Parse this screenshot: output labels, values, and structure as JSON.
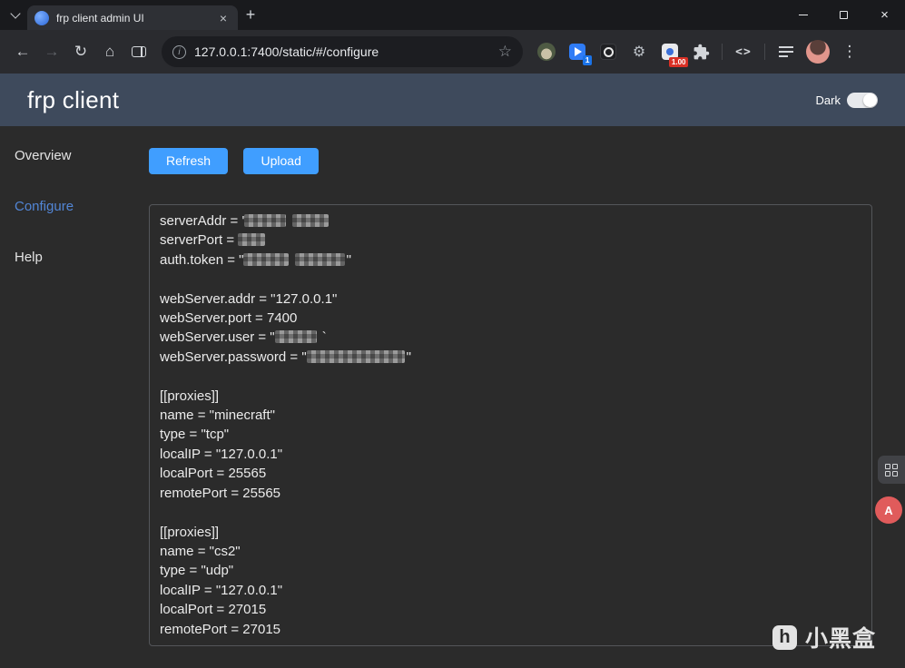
{
  "colors": {
    "primary": "#409eff",
    "header-bg": "#3e4a5c",
    "link-active": "#5286d6",
    "page-bg": "#2b2b2b"
  },
  "browser": {
    "tab_title": "frp client admin UI",
    "url": "127.0.0.1:7400/static/#/configure",
    "flag_badge": "1",
    "red_badge": "1.00",
    "code_glyph": "<>"
  },
  "page": {
    "title": "frp client",
    "theme_label": "Dark",
    "sidebar": [
      "Overview",
      "Configure",
      "Help"
    ],
    "buttons": {
      "refresh": "Refresh",
      "upload": "Upload"
    },
    "config_lines": [
      [
        {
          "t": "serverAddr = '"
        },
        {
          "r": 46
        },
        {
          "t": " "
        },
        {
          "r": 40
        }
      ],
      [
        {
          "t": "serverPort = "
        },
        {
          "r": 30
        }
      ],
      [
        {
          "t": "auth.token = \""
        },
        {
          "r": 50
        },
        {
          "t": " "
        },
        {
          "r": 55
        },
        {
          "t": "\""
        }
      ],
      [],
      [
        {
          "t": "webServer.addr = \"127.0.0.1\""
        }
      ],
      [
        {
          "t": "webServer.port = 7400"
        }
      ],
      [
        {
          "t": "webServer.user = \""
        },
        {
          "r": 46
        },
        {
          "t": " `"
        }
      ],
      [
        {
          "t": "webServer.password = \""
        },
        {
          "r": 108
        },
        {
          "t": "\""
        }
      ],
      [],
      [
        {
          "t": "[[proxies]]"
        }
      ],
      [
        {
          "t": "name = \"minecraft\""
        }
      ],
      [
        {
          "t": "type = \"tcp\""
        }
      ],
      [
        {
          "t": "localIP = \"127.0.0.1\""
        }
      ],
      [
        {
          "t": "localPort = 25565"
        }
      ],
      [
        {
          "t": "remotePort = 25565"
        }
      ],
      [],
      [
        {
          "t": "[[proxies]]"
        }
      ],
      [
        {
          "t": "name = \"cs2\""
        }
      ],
      [
        {
          "t": "type = \"udp\""
        }
      ],
      [
        {
          "t": "localIP = \"127.0.0.1\""
        }
      ],
      [
        {
          "t": "localPort = 27015"
        }
      ],
      [
        {
          "t": "remotePort = 27015"
        }
      ]
    ],
    "watermark": {
      "logo_letter": "h",
      "text": "小黑盒"
    },
    "red_widget_label": "A"
  }
}
